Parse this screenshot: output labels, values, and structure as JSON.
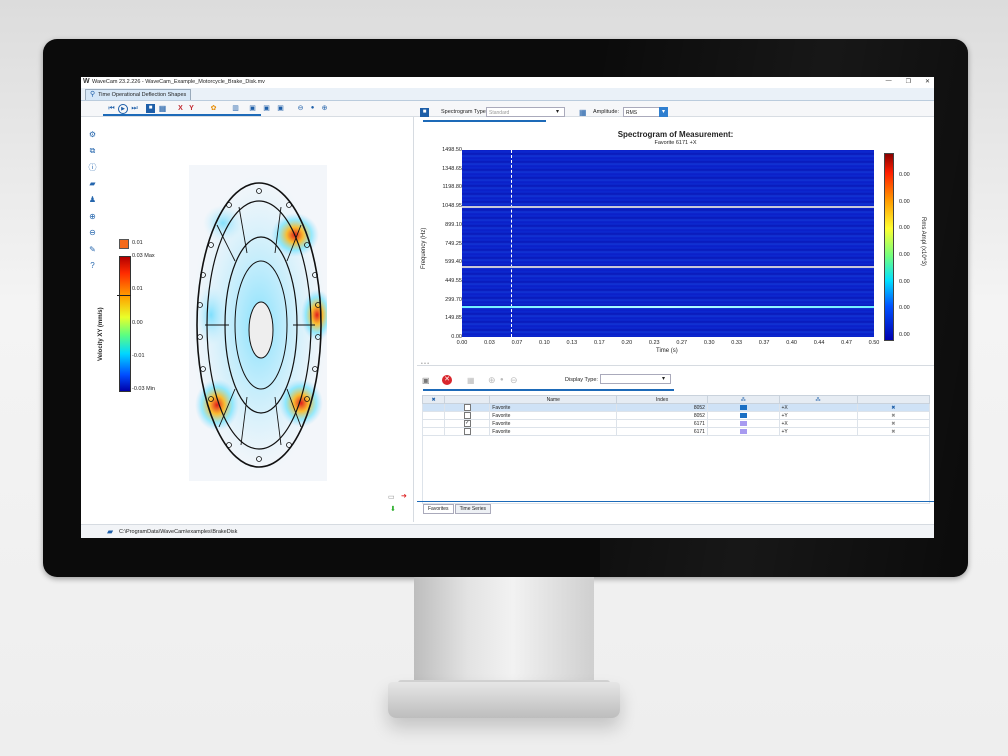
{
  "window": {
    "logo": "W",
    "title": "WaveCam 23.2.226 - WaveCam_Example_Motorcycle_Brake_Disk.mv",
    "controls": [
      "—",
      "❐",
      "✕"
    ]
  },
  "main_tab": {
    "label": "Time Operational Deflection Shapes"
  },
  "toolbar": {
    "icons": [
      "skip-start-icon",
      "play-icon",
      "skip-end-icon",
      "save-icon",
      "table-icon",
      "x-axis-icon",
      "y-axis-icon",
      "color-wheel-icon",
      "layout-icon",
      "image-1-icon",
      "image-2-icon",
      "image-3-icon",
      "zoom-minus-icon",
      "dot-icon",
      "zoom-plus-icon"
    ],
    "x_label": "X",
    "y_label": "Y"
  },
  "left_legend": {
    "swatch_value": "0.01",
    "max_label": "0.03 Max",
    "ticks": [
      "0.01",
      "0.00",
      "-0.01"
    ],
    "min_label": "-0.03 Min",
    "axis_label": "Velocity XY (mm/s)",
    "colors": {
      "swatch": "#f46a1b"
    }
  },
  "spectrogram_controls": {
    "type_label": "Spectrogram Type:",
    "type_value": "Standard",
    "amplitude_label": "Amplitude:",
    "amplitude_value": "RMS"
  },
  "chart_data": {
    "type": "heatmap",
    "title": "Spectrogram of Measurement:",
    "subtitle": "Favorite 6171 +X",
    "xlabel": "Time (s)",
    "ylabel": "Frequency (Hz)",
    "x_ticks": [
      "0.00",
      "0.03",
      "0.07",
      "0.10",
      "0.13",
      "0.17",
      "0.20",
      "0.23",
      "0.27",
      "0.30",
      "0.33",
      "0.37",
      "0.40",
      "0.44",
      "0.47",
      "0.50"
    ],
    "y_ticks": [
      "1498.50",
      "1348.65",
      "1198.80",
      "1048.95",
      "899.10",
      "749.25",
      "599.40",
      "449.55",
      "299.70",
      "149.85",
      "0.00"
    ],
    "xlim": [
      0.0,
      0.5
    ],
    "ylim": [
      0.0,
      1498.5
    ],
    "colorbar_label": "Rms Ampl (x10^3)",
    "colorbar_ticks": [
      "0.00",
      "0.00",
      "0.00",
      "0.00",
      "0.00",
      "0.00",
      "0.00"
    ],
    "cursor_time": 0.06,
    "bright_lines_hz": [
      1045,
      560,
      240
    ]
  },
  "table_panel": {
    "display_type_label": "Display Type:",
    "display_type_value": "",
    "columns": [
      "Name",
      "Index",
      "",
      ""
    ],
    "rows": [
      {
        "checked": false,
        "name": "Favorite",
        "index": "8052",
        "color": "#1a6fc4",
        "dir": "+X",
        "selected": true
      },
      {
        "checked": false,
        "name": "Favorite",
        "index": "8052",
        "color": "#1a6fc4",
        "dir": "+Y",
        "selected": false
      },
      {
        "checked": true,
        "name": "Favorite",
        "index": "6171",
        "color": "#a79af0",
        "dir": "+X",
        "selected": false
      },
      {
        "checked": false,
        "name": "Favorite",
        "index": "6171",
        "color": "#a79af0",
        "dir": "+Y",
        "selected": false
      }
    ],
    "bottom_tabs": [
      "Favorites",
      "Time Series"
    ]
  },
  "status": {
    "path": "C:\\ProgramData\\WaveCam\\examples\\BrakeDisk"
  }
}
